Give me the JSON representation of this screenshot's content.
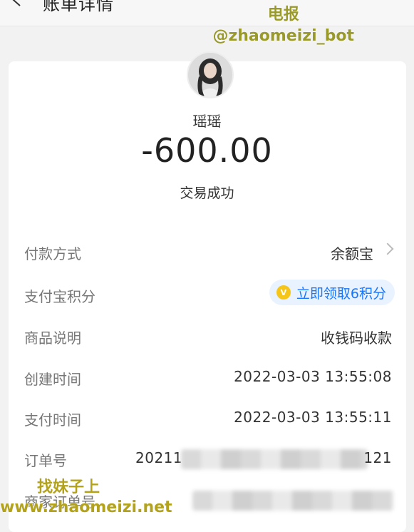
{
  "nav": {
    "title": "账单详情"
  },
  "watermark_top": {
    "line1": "电报",
    "line2": "@zhaomeizi_bot"
  },
  "payee": {
    "name": "瑶瑶",
    "amount": "-600.00",
    "status": "交易成功"
  },
  "rows": {
    "payment_method": {
      "label": "付款方式",
      "value": "余额宝"
    },
    "points": {
      "label": "支付宝积分",
      "value": "立即领取6积分"
    },
    "description": {
      "label": "商品说明",
      "value": "收钱码收款"
    },
    "created": {
      "label": "创建时间",
      "value": "2022-03-03 13:55:08"
    },
    "paid": {
      "label": "支付时间",
      "value": "2022-03-03 13:55:11"
    },
    "order": {
      "label": "订单号",
      "prefix": "20211",
      "suffix": "121"
    },
    "merchant_order": {
      "label": "商家订单号"
    }
  },
  "watermark_bottom": {
    "line1": "找妹子上",
    "line2": "www.zhaomeizi.net"
  },
  "colors": {
    "link_blue": "#1677ff",
    "coin_gold": "#f5c518",
    "watermark": "#b3a21c"
  },
  "icons": {
    "back": "chevron-left-icon",
    "row_arrow": "chevron-right-icon",
    "points": "coin-icon"
  }
}
